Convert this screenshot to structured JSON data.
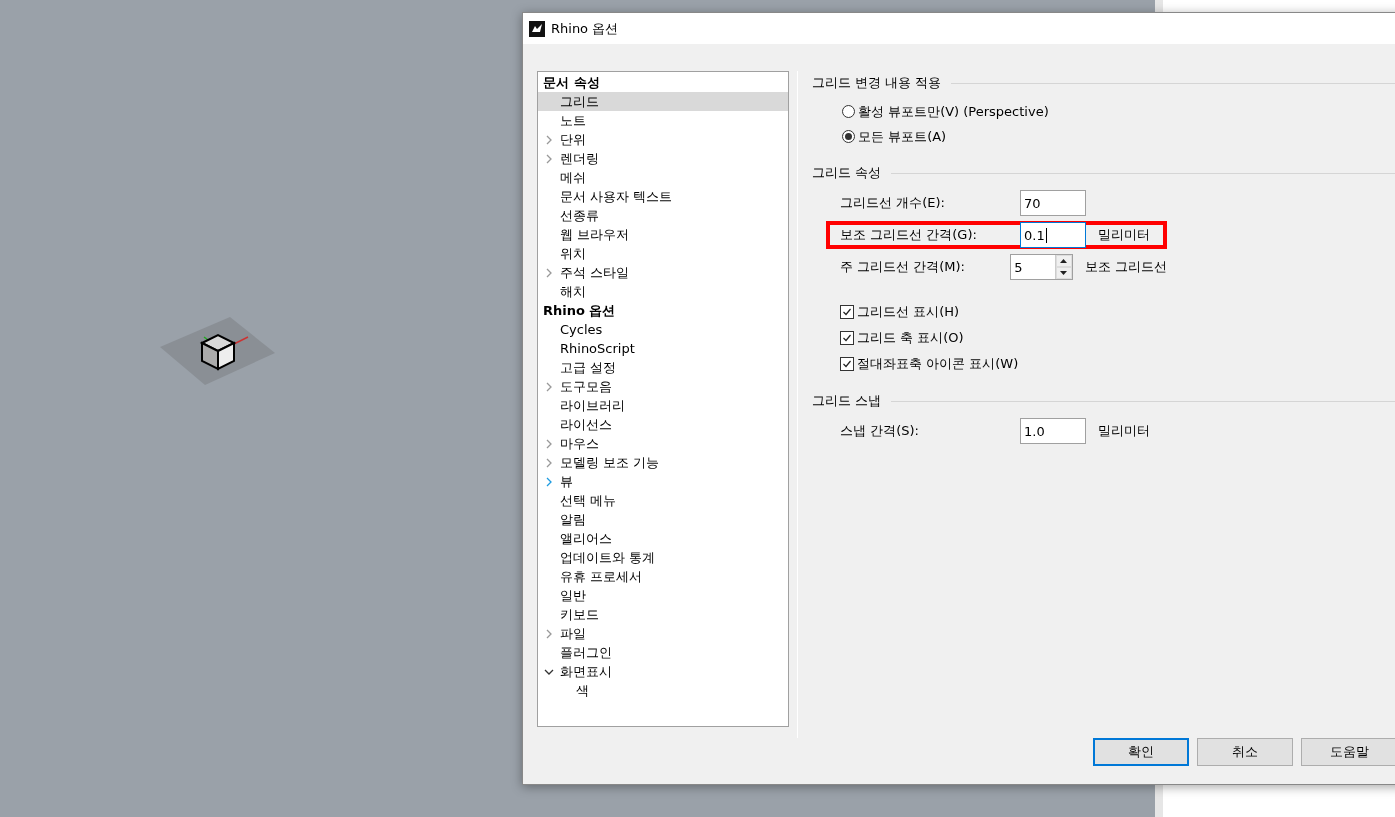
{
  "window": {
    "title": "Rhino 옵션"
  },
  "tree": [
    {
      "label": "문서 속성",
      "kind": "heading",
      "children": [
        {
          "label": "그리드",
          "kind": "leaf",
          "selected": true
        },
        {
          "label": "노트",
          "kind": "leaf",
          "selected": false
        },
        {
          "label": "단위",
          "kind": "collapsed",
          "selected": false,
          "hover": false
        },
        {
          "label": "렌더링",
          "kind": "collapsed",
          "selected": false,
          "hover": false
        },
        {
          "label": "메쉬",
          "kind": "leaf",
          "selected": false
        },
        {
          "label": "문서 사용자 텍스트",
          "kind": "leaf",
          "selected": false
        },
        {
          "label": "선종류",
          "kind": "leaf",
          "selected": false
        },
        {
          "label": "웹 브라우저",
          "kind": "leaf",
          "selected": false
        },
        {
          "label": "위치",
          "kind": "leaf",
          "selected": false
        },
        {
          "label": "주석 스타일",
          "kind": "collapsed",
          "selected": false,
          "hover": false
        },
        {
          "label": "해치",
          "kind": "leaf",
          "selected": false
        }
      ]
    },
    {
      "label": "Rhino 옵션",
      "kind": "heading",
      "children": [
        {
          "label": "Cycles",
          "kind": "leaf",
          "selected": false
        },
        {
          "label": "RhinoScript",
          "kind": "leaf",
          "selected": false
        },
        {
          "label": "고급 설정",
          "kind": "leaf",
          "selected": false
        },
        {
          "label": "도구모음",
          "kind": "collapsed",
          "selected": false,
          "hover": false
        },
        {
          "label": "라이브러리",
          "kind": "leaf",
          "selected": false
        },
        {
          "label": "라이선스",
          "kind": "leaf",
          "selected": false
        },
        {
          "label": "마우스",
          "kind": "collapsed",
          "selected": false,
          "hover": false
        },
        {
          "label": "모델링 보조 기능",
          "kind": "collapsed",
          "selected": false,
          "hover": false
        },
        {
          "label": "뷰",
          "kind": "collapsed",
          "selected": false,
          "hover": true
        },
        {
          "label": "선택 메뉴",
          "kind": "leaf",
          "selected": false
        },
        {
          "label": "알림",
          "kind": "leaf",
          "selected": false
        },
        {
          "label": "앨리어스",
          "kind": "leaf",
          "selected": false
        },
        {
          "label": "업데이트와 통계",
          "kind": "leaf",
          "selected": false
        },
        {
          "label": "유휴 프로세서",
          "kind": "leaf",
          "selected": false
        },
        {
          "label": "일반",
          "kind": "leaf",
          "selected": false
        },
        {
          "label": "키보드",
          "kind": "leaf",
          "selected": false
        },
        {
          "label": "파일",
          "kind": "collapsed",
          "selected": false,
          "hover": false
        },
        {
          "label": "플러그인",
          "kind": "leaf",
          "selected": false
        },
        {
          "label": "화면표시",
          "kind": "expanded",
          "selected": false,
          "children": [
            {
              "label": "색",
              "kind": "leaf",
              "selected": false
            }
          ]
        }
      ]
    }
  ],
  "sections": [
    {
      "title": "그리드 변경 내용 적용",
      "options": [
        {
          "label": "활성 뷰포트만(V) (Perspective)",
          "selected": false
        },
        {
          "label": "모든 뷰포트(A)",
          "selected": true
        }
      ]
    },
    {
      "title": "그리드 속성",
      "fields": [
        {
          "label": "그리드선 개수(E):",
          "value": "70",
          "kind": "text",
          "focused": false,
          "highlighted": false
        },
        {
          "label": "보조 그리드선 간격(G):",
          "value": "0.1",
          "unit": "밀리미터",
          "kind": "text",
          "focused": true,
          "highlighted": true
        },
        {
          "label": "주 그리드선 간격(M):",
          "value": "5",
          "unit": "보조 그리드선",
          "kind": "spinner",
          "focused": false,
          "highlighted": false
        }
      ],
      "checkboxes": [
        {
          "label": "그리드선 표시(H)",
          "checked": true
        },
        {
          "label": "그리드 축 표시(O)",
          "checked": true
        },
        {
          "label": "절대좌표축 아이콘 표시(W)",
          "checked": true
        }
      ]
    },
    {
      "title": "그리드 스냅",
      "fields": [
        {
          "label": "스냅 간격(S):",
          "value": "1.0",
          "unit": "밀리미터",
          "kind": "text",
          "focused": false,
          "highlighted": false
        }
      ]
    }
  ],
  "buttons": [
    {
      "label": "확인",
      "default": true
    },
    {
      "label": "취소",
      "default": false
    },
    {
      "label": "도움말",
      "default": false
    }
  ]
}
